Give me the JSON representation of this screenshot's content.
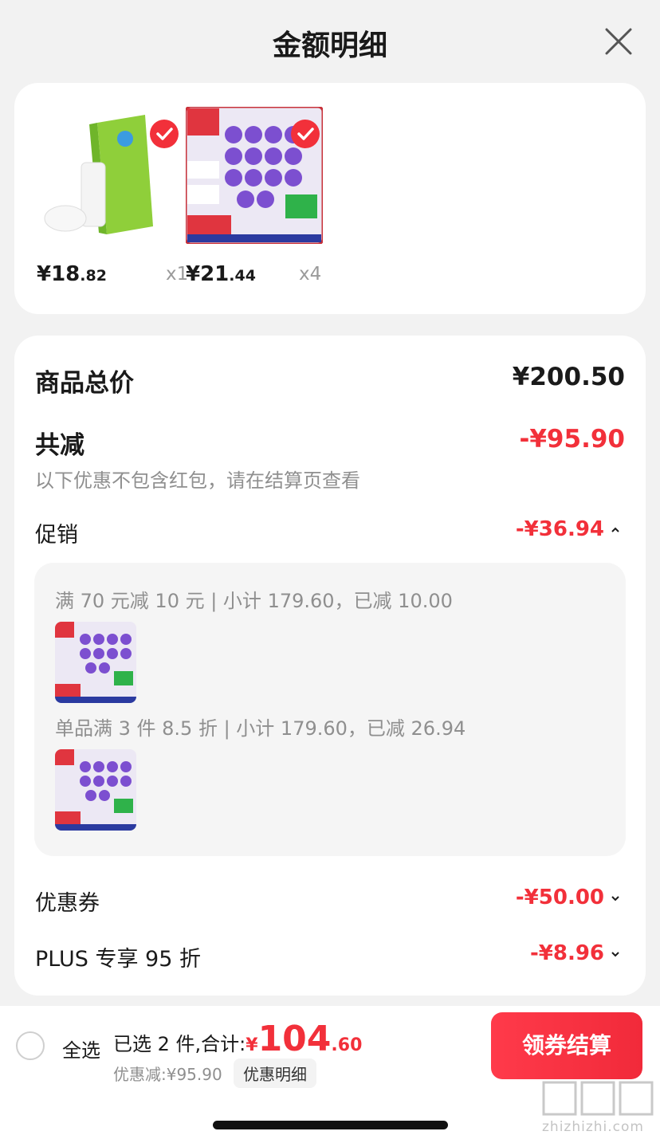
{
  "header": {
    "title": "金额明细"
  },
  "products": [
    {
      "price_int": "¥18",
      "price_dec": ".82",
      "qty": "x1"
    },
    {
      "price_int": "¥21",
      "price_dec": ".44",
      "qty": "x4"
    }
  ],
  "summary": {
    "total_label": "商品总价",
    "total_value": "¥200.50",
    "reduce_label": "共减",
    "reduce_value": "-¥95.90",
    "note": "以下优惠不包含红包，请在结算页查看",
    "promo_label": "促销",
    "promo_value": "-¥36.94",
    "promo_lines": [
      "满 70 元减 10 元 | 小计 179.60，已减 10.00",
      "单品满 3 件 8.5 折 | 小计 179.60，已减 26.94"
    ],
    "coupon_label": "优惠券",
    "coupon_value": "-¥50.00",
    "plus_label": "PLUS 专享 95 折",
    "plus_value": "-¥8.96"
  },
  "bottom_bar": {
    "select_all": "全选",
    "selected_text": "已选 2 件,合计:",
    "currency": "¥",
    "total_int": "104",
    "total_dec": ".60",
    "saved_text": "优惠减:¥95.90",
    "detail_btn": "优惠明细",
    "checkout": "领券结算"
  },
  "watermark": "zhizhizhi.com",
  "colors": {
    "accent": "#f2303a",
    "background": "#f2f2f2"
  }
}
